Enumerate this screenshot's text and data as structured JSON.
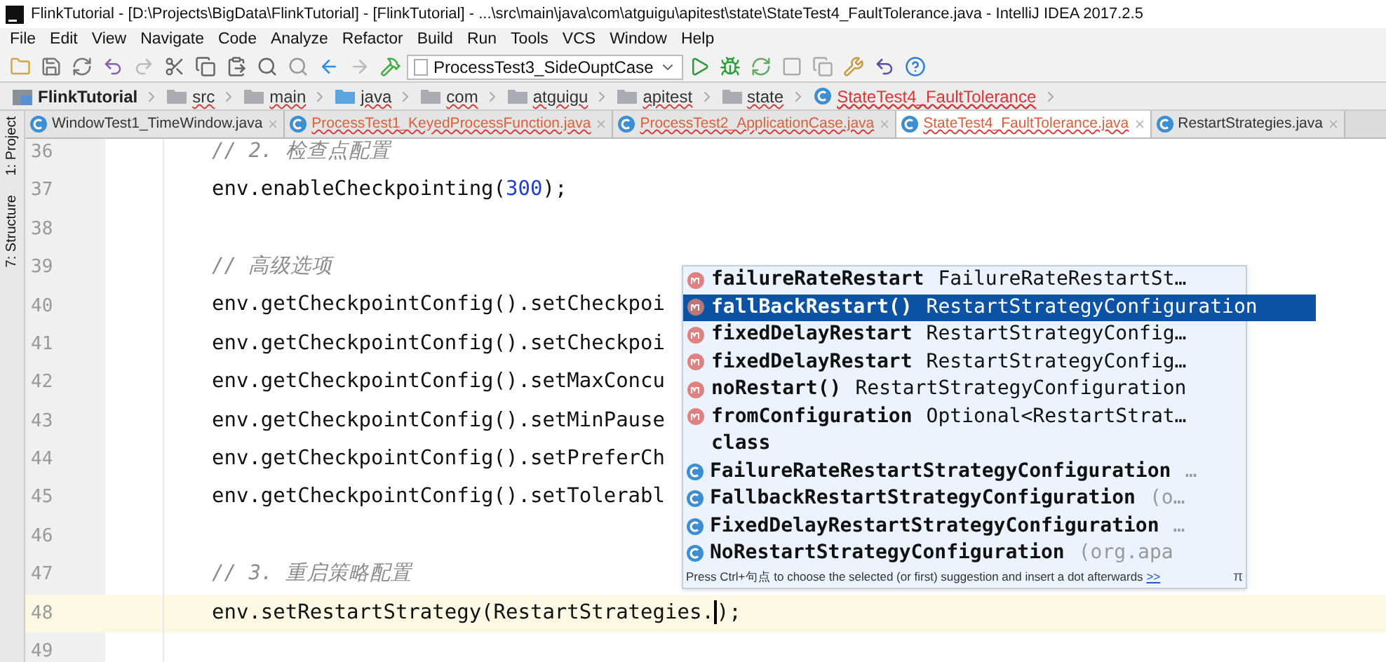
{
  "window": {
    "title": "FlinkTutorial - [D:\\Projects\\BigData\\FlinkTutorial] - [FlinkTutorial] - ...\\src\\main\\java\\com\\atguigu\\apitest\\state\\StateTest4_FaultTolerance.java - IntelliJ IDEA 2017.2.5"
  },
  "menu": [
    "File",
    "Edit",
    "View",
    "Navigate",
    "Code",
    "Analyze",
    "Refactor",
    "Build",
    "Run",
    "Tools",
    "VCS",
    "Window",
    "Help"
  ],
  "toolbar": {
    "run_config": "ProcessTest3_SideOuptCase"
  },
  "breadcrumb": [
    {
      "label": "FlinkTutorial",
      "kind": "project",
      "error": false
    },
    {
      "label": "src",
      "kind": "folder",
      "error": true
    },
    {
      "label": "main",
      "kind": "folder",
      "error": true
    },
    {
      "label": "java",
      "kind": "source",
      "error": true
    },
    {
      "label": "com",
      "kind": "folder",
      "error": true
    },
    {
      "label": "atguigu",
      "kind": "folder",
      "error": true
    },
    {
      "label": "apitest",
      "kind": "folder",
      "error": true
    },
    {
      "label": "state",
      "kind": "folder",
      "error": true
    },
    {
      "label": "StateTest4_FaultTolerance",
      "kind": "class",
      "error": true
    }
  ],
  "side_tools": [
    "1: Project",
    "7: Structure"
  ],
  "tabs": [
    {
      "label": "WindowTest1_TimeWindow.java",
      "selected": false,
      "error": false
    },
    {
      "label": "ProcessTest1_KeyedProcessFunction.java",
      "selected": false,
      "error": true
    },
    {
      "label": "ProcessTest2_ApplicationCase.java",
      "selected": false,
      "error": true
    },
    {
      "label": "StateTest4_FaultTolerance.java",
      "selected": true,
      "error": true
    },
    {
      "label": "RestartStrategies.java",
      "selected": false,
      "error": false
    }
  ],
  "editor": {
    "lines": [
      {
        "number": "36",
        "current": false,
        "tokens": [
          {
            "text": "// 2. 检查点配置",
            "kind": "comment"
          }
        ]
      },
      {
        "number": "37",
        "current": false,
        "tokens": [
          {
            "text": "env.enableCheckpointing(",
            "kind": "plain"
          },
          {
            "text": "300",
            "kind": "number"
          },
          {
            "text": ");",
            "kind": "plain"
          }
        ]
      },
      {
        "number": "38",
        "current": false
      },
      {
        "number": "39",
        "current": false,
        "tokens": [
          {
            "text": "// 高级选项",
            "kind": "comment"
          }
        ]
      },
      {
        "number": "40",
        "current": false,
        "tokens": [
          {
            "text": "env.getCheckpointConfig().setCheckpoi",
            "kind": "plain"
          }
        ]
      },
      {
        "number": "41",
        "current": false,
        "tokens": [
          {
            "text": "env.getCheckpointConfig().setCheckpoi",
            "kind": "plain"
          }
        ]
      },
      {
        "number": "42",
        "current": false,
        "tokens": [
          {
            "text": "env.getCheckpointConfig().setMaxConcu",
            "kind": "plain"
          }
        ]
      },
      {
        "number": "43",
        "current": false,
        "tokens": [
          {
            "text": "env.getCheckpointConfig().setMinPause",
            "kind": "plain"
          }
        ]
      },
      {
        "number": "44",
        "current": false,
        "tokens": [
          {
            "text": "env.getCheckpointConfig().setPreferCh",
            "kind": "plain"
          }
        ]
      },
      {
        "number": "45",
        "current": false,
        "tokens": [
          {
            "text": "env.getCheckpointConfig().setTolerabl",
            "kind": "plain"
          }
        ]
      },
      {
        "number": "46",
        "current": false
      },
      {
        "number": "47",
        "current": false,
        "tokens": [
          {
            "text": "// 3. 重启策略配置",
            "kind": "comment"
          }
        ]
      },
      {
        "number": "48",
        "current": true,
        "tokens": [
          {
            "text": "env.setRestartStrategy(RestartStrategies.",
            "kind": "plain"
          },
          {
            "kind": "caret"
          },
          {
            "text": ");",
            "kind": "plain"
          }
        ]
      },
      {
        "number": "49",
        "current": false
      }
    ]
  },
  "completion": {
    "items": [
      {
        "name": "failureRateRestart",
        "type": "FailureRateRestartSt…",
        "kind": "method",
        "selected": false
      },
      {
        "name": "fallBackRestart()",
        "type": "RestartStrategyConfiguration",
        "kind": "method",
        "selected": true
      },
      {
        "name": "fixedDelayRestart",
        "type": "RestartStrategyConfig…",
        "kind": "method",
        "selected": false
      },
      {
        "name": "fixedDelayRestart",
        "type": "RestartStrategyConfig…",
        "kind": "method",
        "selected": false
      },
      {
        "name": "noRestart()",
        "type": "RestartStrategyConfiguration",
        "kind": "method",
        "selected": false
      },
      {
        "name": "fromConfiguration",
        "type": "Optional<RestartStrat…",
        "kind": "method",
        "selected": false
      },
      {
        "name": "class",
        "kind": "keyword",
        "selected": false
      },
      {
        "name": "FailureRateRestartStrategyConfiguration",
        "type": "…",
        "kind": "class",
        "selected": false
      },
      {
        "name": "FallbackRestartStrategyConfiguration",
        "type": "(o…",
        "kind": "class",
        "selected": false
      },
      {
        "name": "FixedDelayRestartStrategyConfiguration",
        "type": "…",
        "kind": "class",
        "selected": false
      },
      {
        "name": "NoRestartStrategyConfiguration",
        "type": "(org.apa",
        "kind": "class",
        "selected": false
      }
    ],
    "hint": "Press Ctrl+句点 to choose the selected (or first) suggestion and insert a dot afterwards",
    "hint_link": ">>",
    "pi": "π"
  }
}
